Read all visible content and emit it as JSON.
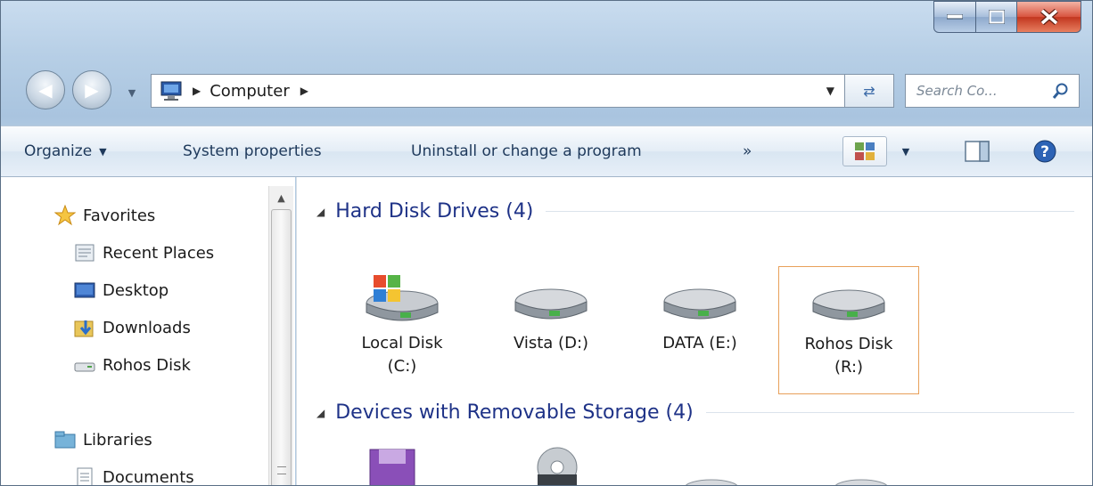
{
  "breadcrumb": [
    "Computer"
  ],
  "search": {
    "placeholder": "Search Co..."
  },
  "toolbar": {
    "organize": "Organize",
    "system_properties": "System properties",
    "uninstall": "Uninstall or change a program",
    "more": "»"
  },
  "nav": {
    "favorites": "Favorites",
    "recent_places": "Recent Places",
    "desktop": "Desktop",
    "downloads": "Downloads",
    "rohos_disk": "Rohos Disk",
    "libraries": "Libraries",
    "documents": "Documents"
  },
  "groups": {
    "hdd_title": "Hard Disk Drives (4)",
    "removable_title": "Devices with Removable Storage (4)"
  },
  "drives": [
    {
      "line1": "Local Disk",
      "line2": "(C:)",
      "icon": "windows-drive-icon"
    },
    {
      "line1": "Vista (D:)",
      "line2": "",
      "icon": "hard-drive-icon"
    },
    {
      "line1": "DATA (E:)",
      "line2": "",
      "icon": "hard-drive-icon"
    },
    {
      "line1": "Rohos Disk",
      "line2": "(R:)",
      "icon": "hard-drive-icon",
      "selected": true
    }
  ],
  "colors": {
    "accent": "#1e3287",
    "selection_border": "#e8a05a",
    "close_button": "#c2361f"
  }
}
